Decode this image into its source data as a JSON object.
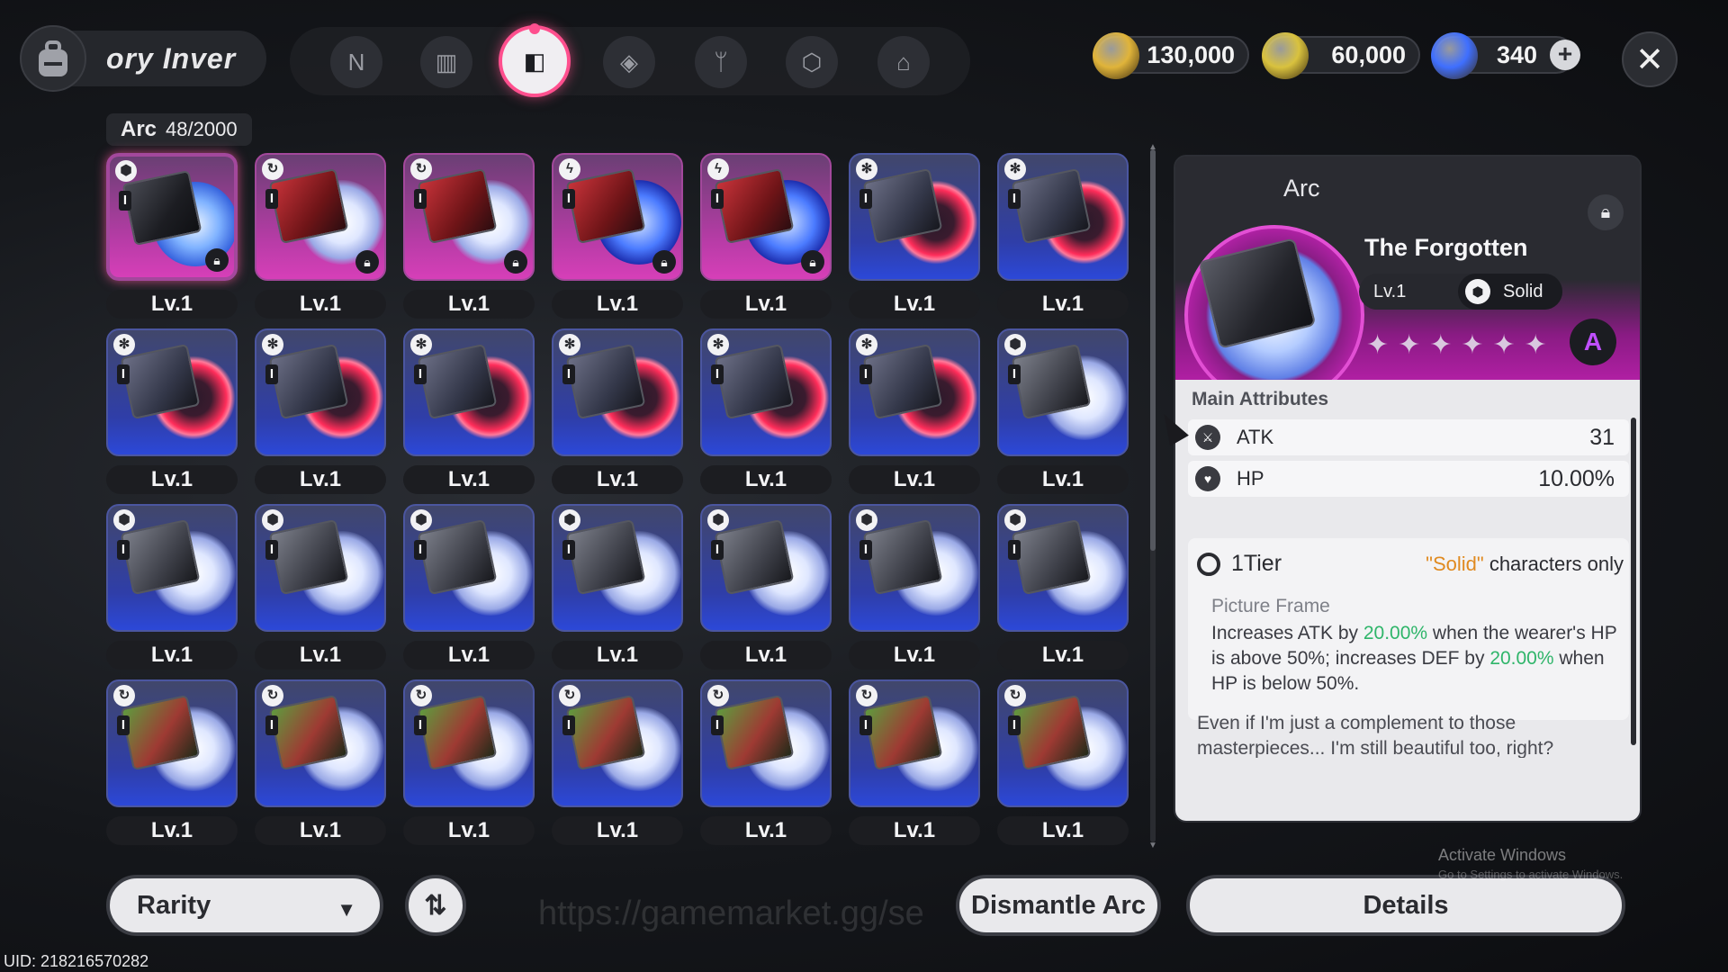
{
  "header": {
    "title": "ory  Inver",
    "tabs": [
      {
        "name": "tab-character",
        "icon": "N"
      },
      {
        "name": "tab-device",
        "icon": "▥"
      },
      {
        "name": "tab-arc",
        "icon": "◧",
        "active": true
      },
      {
        "name": "tab-material",
        "icon": "◈"
      },
      {
        "name": "tab-food",
        "icon": "ᛘ"
      },
      {
        "name": "tab-module",
        "icon": "⬡"
      },
      {
        "name": "tab-home",
        "icon": "⌂"
      }
    ],
    "currencies": [
      {
        "id": "gold",
        "value": "130,000",
        "color": "#e0b43a"
      },
      {
        "id": "ticket",
        "value": "60,000",
        "color": "#d9c23e"
      },
      {
        "id": "crystal",
        "value": "340",
        "color": "#3f6fff",
        "has_plus": true
      }
    ],
    "close_label": "✕"
  },
  "inventory": {
    "category": "Arc",
    "count": "48/2000",
    "lvl_label": "Lv.1",
    "items": [
      {
        "badge": "⬢",
        "box": "dark",
        "disc": "blue",
        "locked": true,
        "selected": true,
        "pink": true
      },
      {
        "badge": "↻",
        "box": "red",
        "disc": "white",
        "locked": true,
        "pink": true
      },
      {
        "badge": "↻",
        "box": "red",
        "disc": "white",
        "locked": true,
        "pink": true
      },
      {
        "badge": "ϟ",
        "box": "red",
        "disc": "storm",
        "locked": true,
        "pink": true
      },
      {
        "badge": "ϟ",
        "box": "red",
        "disc": "storm",
        "locked": true,
        "pink": true
      },
      {
        "badge": "✻",
        "box": "purple",
        "disc": "red",
        "locked": false
      },
      {
        "badge": "✻",
        "box": "purple",
        "disc": "red",
        "locked": false
      },
      {
        "badge": "✻",
        "box": "purple",
        "disc": "red",
        "locked": false
      },
      {
        "badge": "✻",
        "box": "purple",
        "disc": "red",
        "locked": false
      },
      {
        "badge": "✻",
        "box": "purple",
        "disc": "red",
        "locked": false
      },
      {
        "badge": "✻",
        "box": "purple",
        "disc": "red",
        "locked": false
      },
      {
        "badge": "✻",
        "box": "purple",
        "disc": "red",
        "locked": false
      },
      {
        "badge": "✻",
        "box": "purple",
        "disc": "red",
        "locked": false
      },
      {
        "badge": "⬢",
        "box": "gray",
        "disc": "white",
        "locked": false
      },
      {
        "badge": "⬢",
        "box": "gray",
        "disc": "white",
        "locked": false
      },
      {
        "badge": "⬢",
        "box": "gray",
        "disc": "white",
        "locked": false
      },
      {
        "badge": "⬢",
        "box": "gray",
        "disc": "white",
        "locked": false
      },
      {
        "badge": "⬢",
        "box": "gray",
        "disc": "white",
        "locked": false
      },
      {
        "badge": "⬢",
        "box": "gray",
        "disc": "white",
        "locked": false
      },
      {
        "badge": "⬢",
        "box": "gray",
        "disc": "white",
        "locked": false
      },
      {
        "badge": "⬢",
        "box": "gray",
        "disc": "white",
        "locked": false
      },
      {
        "badge": "↻",
        "box": "green",
        "disc": "white",
        "locked": false
      },
      {
        "badge": "↻",
        "box": "green",
        "disc": "white",
        "locked": false
      },
      {
        "badge": "↻",
        "box": "green",
        "disc": "white",
        "locked": false
      },
      {
        "badge": "↻",
        "box": "green",
        "disc": "white",
        "locked": false
      },
      {
        "badge": "↻",
        "box": "green",
        "disc": "white",
        "locked": false
      },
      {
        "badge": "↻",
        "box": "green",
        "disc": "white",
        "locked": false
      },
      {
        "badge": "↻",
        "box": "green",
        "disc": "white",
        "locked": false
      }
    ]
  },
  "detail": {
    "category": "Arc",
    "name": "The Forgotten",
    "level": "Lv.1",
    "element": "Solid",
    "stars": "✦✦✦✦✦✦",
    "rank": "A",
    "main_attributes_title": "Main Attributes",
    "attributes": [
      {
        "name": "ATK",
        "value": "31",
        "icon": "⚔"
      },
      {
        "name": "HP",
        "value": "10.00%",
        "icon": "♥"
      }
    ],
    "tier_label": "1Tier",
    "tier_req_highlight": "\"Solid\"",
    "tier_req_rest": " characters only",
    "skill_name": "Picture Frame",
    "skill_desc_1": "Increases ATK by ",
    "skill_val_1": "20.00%",
    "skill_desc_2": " when the wearer's HP is above 50%; increases DEF by ",
    "skill_val_2": "20.00%",
    "skill_desc_3": " when HP is below 50%.",
    "flavor": "Even if I'm just a complement to those masterpieces... I'm still beautiful too, right?"
  },
  "bottom": {
    "rarity_label": "Rarity",
    "sort_icon": "⇅",
    "watermark": "https://gamemarket.gg/se",
    "dismantle_label": "Dismantle Arc",
    "details_label": "Details",
    "activate_title": "Activate Windows",
    "activate_sub": "Go to Settings to activate Windows.",
    "uid": "UID: 218216570282"
  }
}
